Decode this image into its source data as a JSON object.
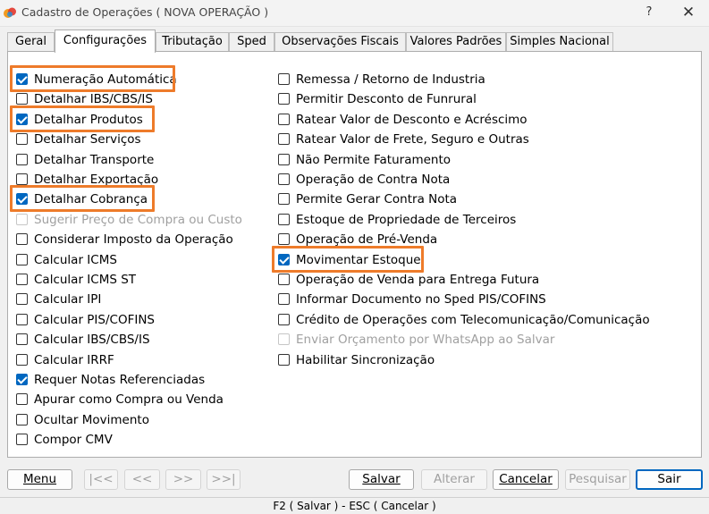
{
  "window": {
    "title": "Cadastro de Operações ( NOVA OPERAÇÃO )",
    "help_label": "?",
    "close_label": "✕"
  },
  "tabs": [
    {
      "label": "Geral",
      "active": false
    },
    {
      "label": "Configurações",
      "active": true
    },
    {
      "label": "Tributação",
      "active": false
    },
    {
      "label": "Sped",
      "active": false
    },
    {
      "label": "Observações Fiscais",
      "active": false
    },
    {
      "label": "Valores Padrões",
      "active": false
    },
    {
      "label": "Simples Nacional",
      "active": false
    }
  ],
  "left_options": [
    {
      "label": "Numeração Automática",
      "checked": true,
      "enabled": true,
      "highlighted": true
    },
    {
      "label": "Detalhar IBS/CBS/IS",
      "checked": false,
      "enabled": true,
      "highlighted": false
    },
    {
      "label": "Detalhar Produtos",
      "checked": true,
      "enabled": true,
      "highlighted": true
    },
    {
      "label": "Detalhar Serviços",
      "checked": false,
      "enabled": true,
      "highlighted": false
    },
    {
      "label": "Detalhar Transporte",
      "checked": false,
      "enabled": true,
      "highlighted": false
    },
    {
      "label": "Detalhar Exportação",
      "checked": false,
      "enabled": true,
      "highlighted": false
    },
    {
      "label": "Detalhar Cobrança",
      "checked": true,
      "enabled": true,
      "highlighted": true
    },
    {
      "label": "Sugerir Preço de Compra ou Custo",
      "checked": false,
      "enabled": false,
      "highlighted": false
    },
    {
      "label": "Considerar Imposto da Operação",
      "checked": false,
      "enabled": true,
      "highlighted": false
    },
    {
      "label": "Calcular ICMS",
      "checked": false,
      "enabled": true,
      "highlighted": false
    },
    {
      "label": "Calcular ICMS ST",
      "checked": false,
      "enabled": true,
      "highlighted": false
    },
    {
      "label": "Calcular IPI",
      "checked": false,
      "enabled": true,
      "highlighted": false
    },
    {
      "label": "Calcular PIS/COFINS",
      "checked": false,
      "enabled": true,
      "highlighted": false
    },
    {
      "label": "Calcular IBS/CBS/IS",
      "checked": false,
      "enabled": true,
      "highlighted": false
    },
    {
      "label": "Calcular IRRF",
      "checked": false,
      "enabled": true,
      "highlighted": false
    },
    {
      "label": "Requer Notas Referenciadas",
      "checked": true,
      "enabled": true,
      "highlighted": false
    },
    {
      "label": "Apurar como Compra ou Venda",
      "checked": false,
      "enabled": true,
      "highlighted": false
    },
    {
      "label": "Ocultar Movimento",
      "checked": false,
      "enabled": true,
      "highlighted": false
    },
    {
      "label": "Compor CMV",
      "checked": false,
      "enabled": true,
      "highlighted": false
    }
  ],
  "right_options": [
    {
      "label": "Remessa / Retorno de Industria",
      "checked": false,
      "enabled": true,
      "highlighted": false
    },
    {
      "label": "Permitir Desconto de Funrural",
      "checked": false,
      "enabled": true,
      "highlighted": false
    },
    {
      "label": "Ratear Valor de Desconto e Acréscimo",
      "checked": false,
      "enabled": true,
      "highlighted": false
    },
    {
      "label": "Ratear Valor de Frete, Seguro e Outras",
      "checked": false,
      "enabled": true,
      "highlighted": false
    },
    {
      "label": "Não Permite Faturamento",
      "checked": false,
      "enabled": true,
      "highlighted": false
    },
    {
      "label": "Operação de Contra Nota",
      "checked": false,
      "enabled": true,
      "highlighted": false
    },
    {
      "label": "Permite Gerar Contra Nota",
      "checked": false,
      "enabled": true,
      "highlighted": false
    },
    {
      "label": "Estoque de Propriedade de Terceiros",
      "checked": false,
      "enabled": true,
      "highlighted": false
    },
    {
      "label": "Operação de Pré-Venda",
      "checked": false,
      "enabled": true,
      "highlighted": false
    },
    {
      "label": "Movimentar Estoque",
      "checked": true,
      "enabled": true,
      "highlighted": true
    },
    {
      "label": "Operação de Venda para Entrega Futura",
      "checked": false,
      "enabled": true,
      "highlighted": false
    },
    {
      "label": "Informar Documento no Sped PIS/COFINS",
      "checked": false,
      "enabled": true,
      "highlighted": false
    },
    {
      "label": "Crédito de Operações com Telecomunicação/Comunicação",
      "checked": false,
      "enabled": true,
      "highlighted": false
    },
    {
      "label": "Enviar Orçamento por WhatsApp ao Salvar",
      "checked": false,
      "enabled": false,
      "highlighted": false
    },
    {
      "label": "Habilitar Sincronização",
      "checked": false,
      "enabled": true,
      "highlighted": false
    }
  ],
  "buttons": {
    "menu": "Menu",
    "first": "|<<",
    "prev": "<<",
    "next": ">>",
    "last": ">>|",
    "save": "Salvar",
    "edit": "Alterar",
    "cancel": "Cancelar",
    "search": "Pesquisar",
    "exit": "Sair"
  },
  "status_bar": "F2 ( Salvar )  -  ESC ( Cancelar )",
  "colors": {
    "highlight": "#ee7b2a",
    "checkbox_checked": "#0067c0"
  }
}
